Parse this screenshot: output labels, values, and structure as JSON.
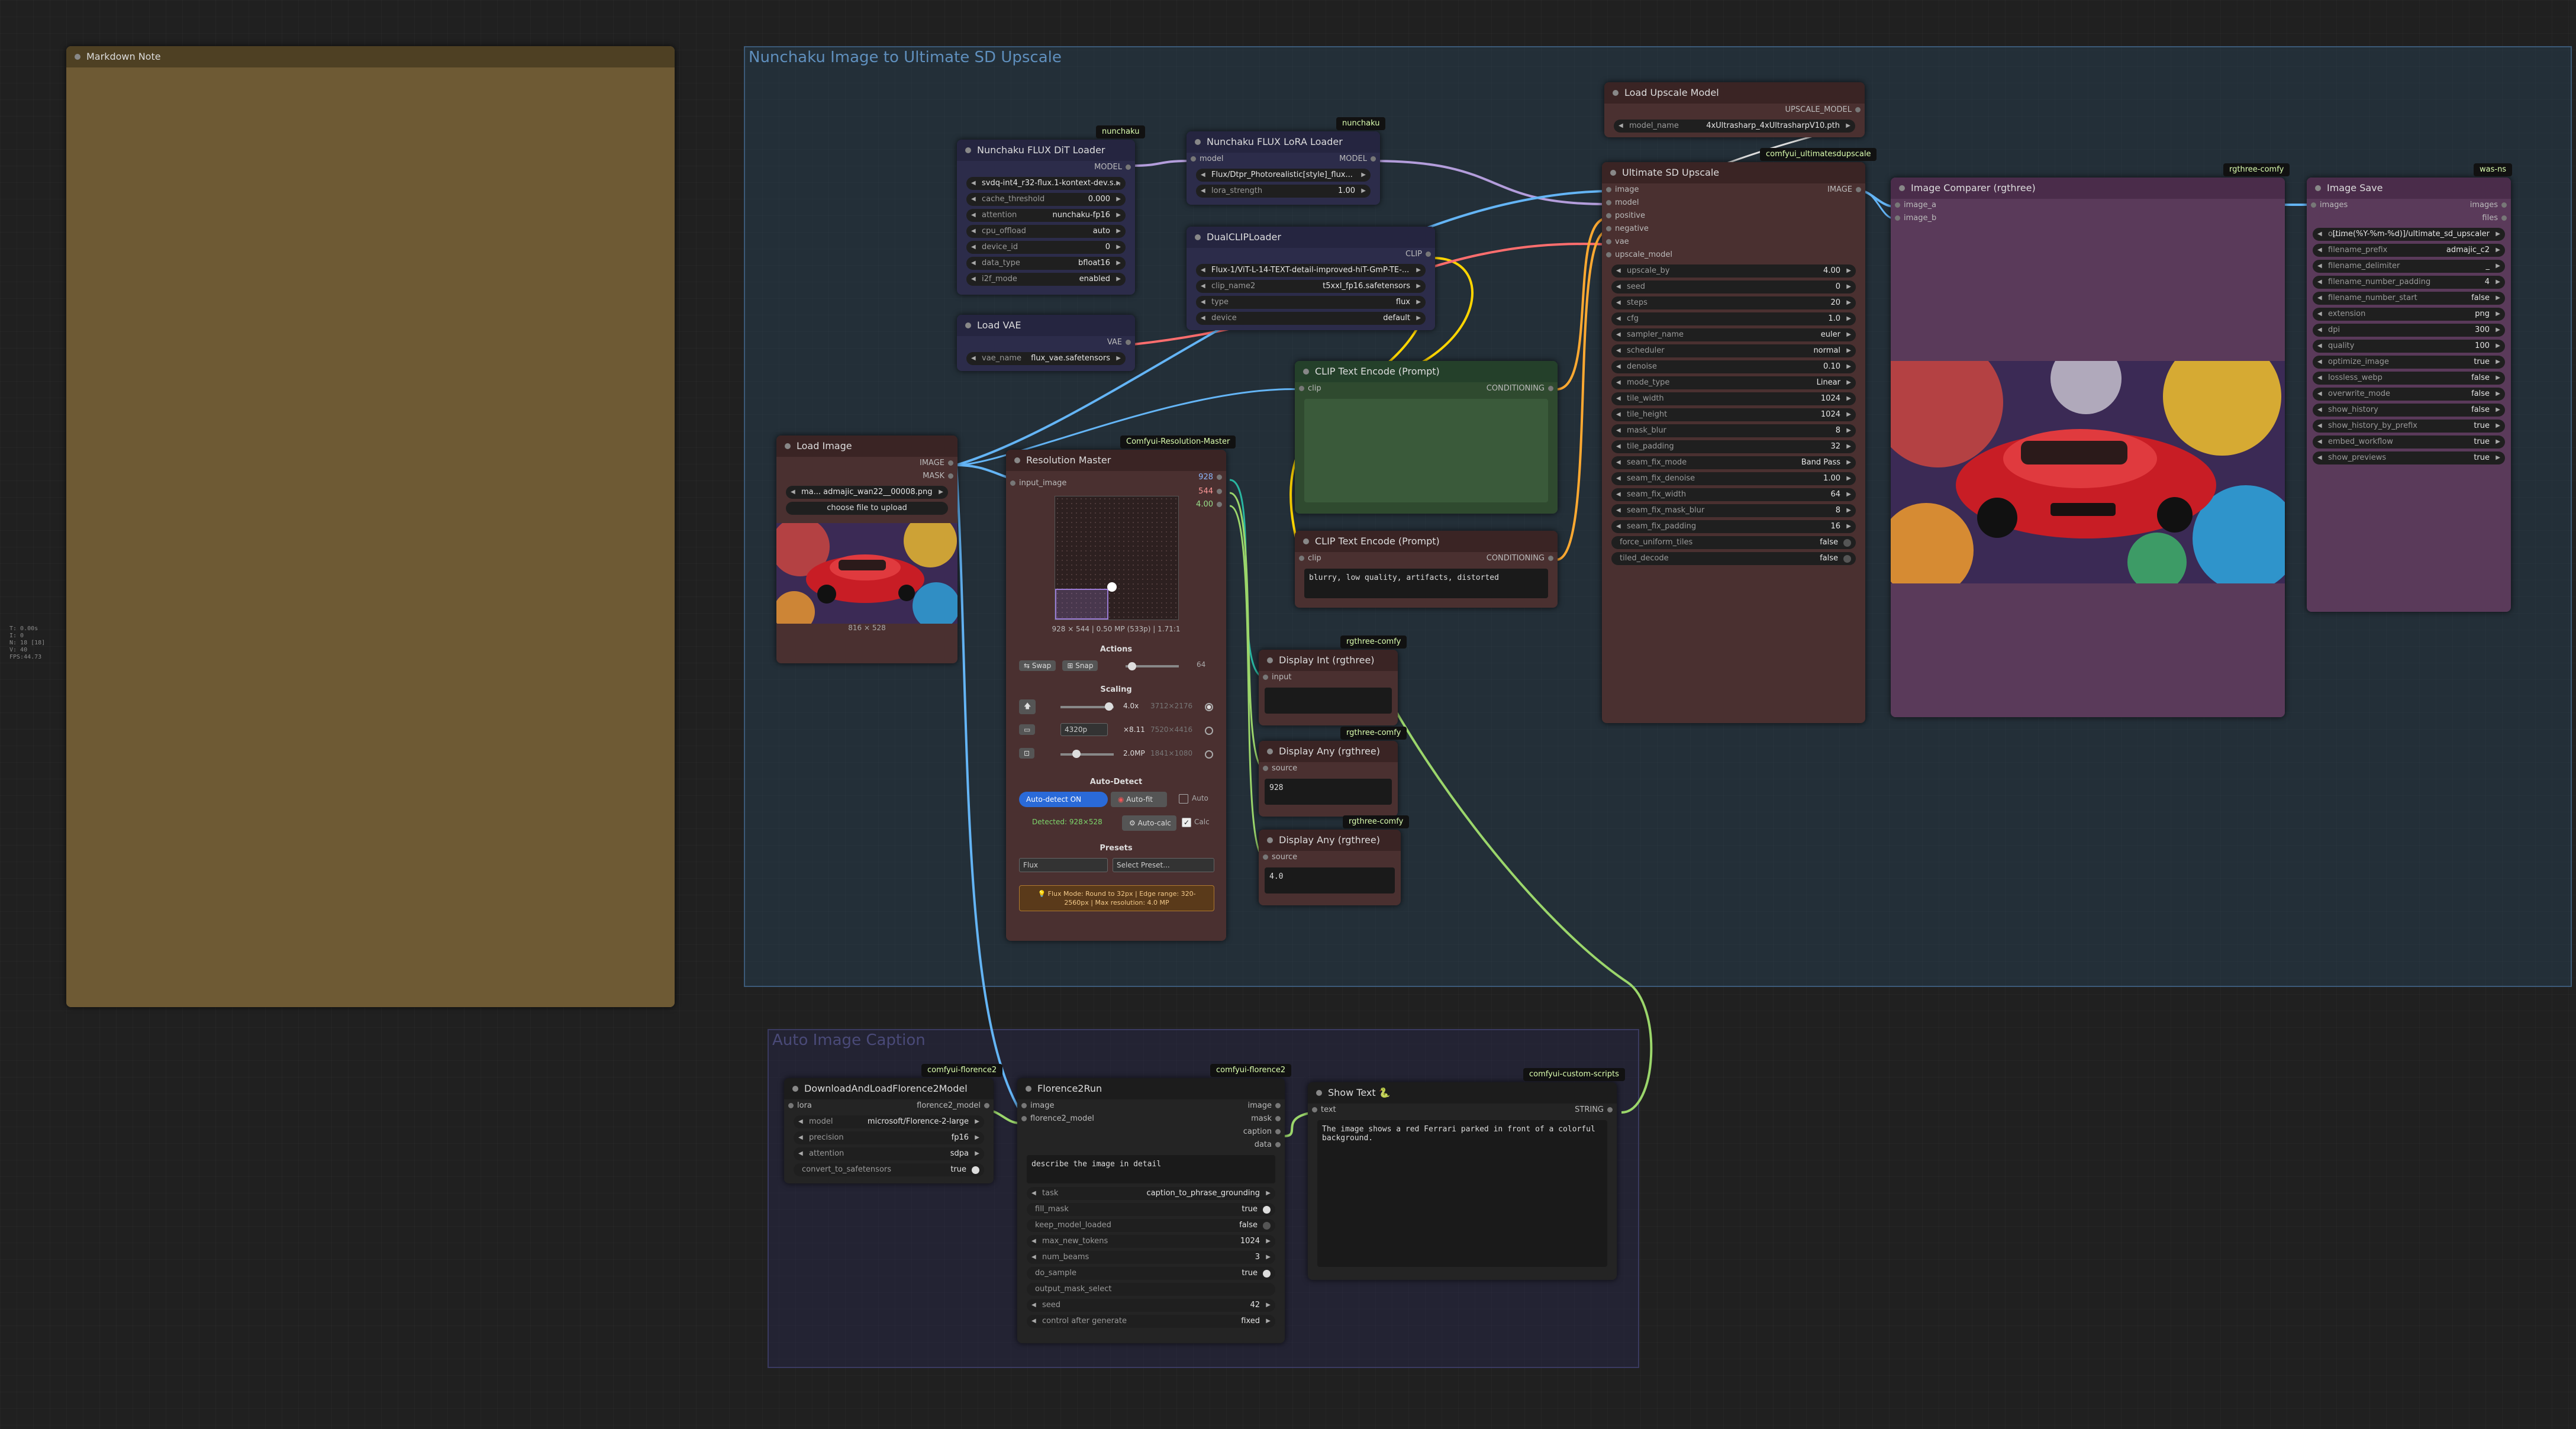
{
  "colors": {
    "model": "#b39ddb",
    "clip": "#ffd500",
    "vae": "#ff6e6e",
    "image": "#64b5f6",
    "conditioning": "#ffa931",
    "any": "#9bd66b"
  },
  "stats": [
    "T: 0.00s",
    "I: 0",
    "N: 18 [18]",
    "V: 40",
    "FPS:44.73"
  ],
  "groups": {
    "g1": "Nunchaku Image to Ultimate SD Upscale",
    "g2": "Auto Image Caption"
  },
  "markdown": {
    "title": "Markdown Note"
  },
  "dit": {
    "badge": "nunchaku",
    "title": "Nunchaku FLUX DiT Loader",
    "out": "MODEL",
    "w": [
      [
        "",
        "svdq-int4_r32-flux.1-kontext-dev.s..."
      ],
      [
        "cache_threshold",
        "0.000"
      ],
      [
        "attention",
        "nunchaku-fp16"
      ],
      [
        "cpu_offload",
        "auto"
      ],
      [
        "device_id",
        "0"
      ],
      [
        "data_type",
        "bfloat16"
      ],
      [
        "i2f_mode",
        "enabled"
      ]
    ]
  },
  "lora": {
    "badge": "nunchaku",
    "title": "Nunchaku FLUX LoRA Loader",
    "in": "model",
    "out": "MODEL",
    "w": [
      [
        "",
        "Flux/Dtpr_Photorealistic[style]_flux..."
      ],
      [
        "lora_strength",
        "1.00"
      ]
    ]
  },
  "dual": {
    "title": "DualCLIPLoader",
    "out": "CLIP",
    "w": [
      [
        "",
        "Flux-1/ViT-L-14-TEXT-detail-improved-hiT-GmP-TE-..."
      ],
      [
        "clip_name2",
        "t5xxl_fp16.safetensors"
      ],
      [
        "type",
        "flux"
      ],
      [
        "device",
        "default"
      ]
    ]
  },
  "vae": {
    "title": "Load VAE",
    "out": "VAE",
    "w": [
      [
        "vae_name",
        "flux_vae.safetensors"
      ]
    ]
  },
  "load_image": {
    "title": "Load Image",
    "outs": [
      "IMAGE",
      "MASK"
    ],
    "file": "ma... admajic_wan22__00008.png",
    "upload": "choose file to upload",
    "size": "816 × 528"
  },
  "resmaster": {
    "badge": "Comfyui-Resolution-Master",
    "title": "Resolution Master",
    "in": "input_image",
    "out_w": "928",
    "out_h": "544",
    "out_s": "4.00",
    "info": "928 × 544  |  0.50 MP (533p)  |  1.71:1",
    "actions": "Actions",
    "swap": "⇆ Swap",
    "snap": "⊞ Snap",
    "snap_val": "64",
    "scaling": "Scaling",
    "scale_val": "4.0x",
    "scale_res": "3712×2176",
    "res_sel": "4320p",
    "res_factor": "×8.11",
    "res_res": "7520×4416",
    "mp_val": "2.0MP",
    "mp_res": "1841×1080",
    "autodetect": "Auto-Detect",
    "ad_on": "Auto-detect ON",
    "autofit": "Auto-fit",
    "auto": "Auto",
    "autocalc": "Auto-calc",
    "calc": "Calc",
    "detected": "Detected: 928×528",
    "presets": "Presets",
    "preset_cat": "Flux",
    "preset_sel": "Select Preset...",
    "tip": "💡 Flux Mode: Round to 32px | Edge range: 320-2560px | Max resolution: 4.0 MP"
  },
  "clip_pos": {
    "title": "CLIP Text Encode (Prompt)",
    "in": "clip",
    "out": "CONDITIONING",
    "text": ""
  },
  "clip_neg": {
    "title": "CLIP Text Encode (Prompt)",
    "in": "clip",
    "out": "CONDITIONING",
    "text": "blurry, low quality, artifacts, distorted"
  },
  "disp_int": {
    "badge": "rgthree-comfy",
    "title": "Display Int (rgthree)",
    "in": "input",
    "value": ""
  },
  "disp_any1": {
    "badge": "rgthree-comfy",
    "title": "Display Any (rgthree)",
    "in": "source",
    "value": "928"
  },
  "disp_any2": {
    "badge": "rgthree-comfy",
    "title": "Display Any (rgthree)",
    "in": "source",
    "value": "4.0"
  },
  "upmodel": {
    "title": "Load Upscale Model",
    "out": "UPSCALE_MODEL",
    "w": [
      [
        "model_name",
        "4xUltrasharp_4xUltrasharpV10.pth"
      ]
    ]
  },
  "usd": {
    "badge": "comfyui_ultimatesdupscale",
    "title": "Ultimate SD Upscale",
    "out": "IMAGE",
    "ins": [
      "image",
      "model",
      "positive",
      "negative",
      "vae",
      "upscale_model"
    ],
    "w": [
      [
        "upscale_by",
        "4.00"
      ],
      [
        "seed",
        "0"
      ],
      [
        "steps",
        "20"
      ],
      [
        "cfg",
        "1.0"
      ],
      [
        "sampler_name",
        "euler"
      ],
      [
        "scheduler",
        "normal"
      ],
      [
        "denoise",
        "0.10"
      ],
      [
        "mode_type",
        "Linear"
      ],
      [
        "tile_width",
        "1024"
      ],
      [
        "tile_height",
        "1024"
      ],
      [
        "mask_blur",
        "8"
      ],
      [
        "tile_padding",
        "32"
      ],
      [
        "seam_fix_mode",
        "Band Pass"
      ],
      [
        "seam_fix_denoise",
        "1.00"
      ],
      [
        "seam_fix_width",
        "64"
      ],
      [
        "seam_fix_mask_blur",
        "8"
      ],
      [
        "seam_fix_padding",
        "16"
      ]
    ],
    "t": [
      [
        "force_uniform_tiles",
        "false"
      ],
      [
        "tiled_decode",
        "false"
      ]
    ]
  },
  "comparer": {
    "badge": "rgthree-comfy",
    "title": "Image Comparer (rgthree)",
    "ins": [
      "image_a",
      "image_b"
    ]
  },
  "save": {
    "badge": "was-ns",
    "title": "Image Save",
    "in": "images",
    "out": "images",
    "out2": "files",
    "w": [
      [
        "ou...",
        "[time(%Y-%m-%d)]/ultimate_sd_upscaler"
      ],
      [
        "filename_prefix",
        "admajic_c2"
      ],
      [
        "filename_delimiter",
        "_"
      ],
      [
        "filename_number_padding",
        "4"
      ],
      [
        "filename_number_start",
        "false"
      ],
      [
        "extension",
        "png"
      ],
      [
        "dpi",
        "300"
      ],
      [
        "quality",
        "100"
      ],
      [
        "optimize_image",
        "true"
      ],
      [
        "lossless_webp",
        "false"
      ],
      [
        "overwrite_mode",
        "false"
      ],
      [
        "show_history",
        "false"
      ],
      [
        "show_history_by_prefix",
        "true"
      ],
      [
        "embed_workflow",
        "true"
      ],
      [
        "show_previews",
        "true"
      ]
    ]
  },
  "florence_load": {
    "badge": "comfyui-florence2",
    "title": "DownloadAndLoadFlorence2Model",
    "in": "lora",
    "out": "florence2_model",
    "w": [
      [
        "model",
        "microsoft/Florence-2-large"
      ],
      [
        "precision",
        "fp16"
      ],
      [
        "attention",
        "sdpa"
      ]
    ],
    "t": [
      [
        "convert_to_safetensors",
        "true"
      ]
    ]
  },
  "florence_run": {
    "badge": "comfyui-florence2",
    "title": "Florence2Run",
    "ins": [
      "image",
      "florence2_model"
    ],
    "outs": [
      "image",
      "mask",
      "caption",
      "data"
    ],
    "prompt": "describe the image in detail",
    "w": [
      [
        "task",
        "caption_to_phrase_grounding"
      ]
    ],
    "t": [
      [
        "fill_mask",
        "true"
      ],
      [
        "keep_model_loaded",
        "false"
      ]
    ],
    "w2": [
      [
        "max_new_tokens",
        "1024"
      ],
      [
        "num_beams",
        "3"
      ]
    ],
    "t2": [
      [
        "do_sample",
        "true"
      ],
      [
        "output_mask_select",
        ""
      ]
    ],
    "w3": [
      [
        "seed",
        "42"
      ],
      [
        "control after generate",
        "fixed"
      ]
    ]
  },
  "show_text": {
    "badge": "comfyui-custom-scripts",
    "title": "Show Text 🐍",
    "in": "text",
    "out": "STRING",
    "text": "The image shows a red Ferrari parked in front of a colorful background."
  }
}
